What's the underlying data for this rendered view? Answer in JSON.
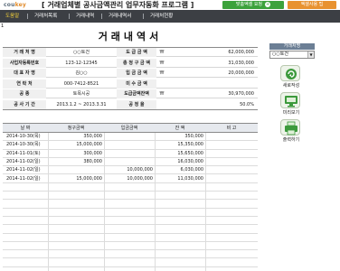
{
  "header": {
    "logo": "cou",
    "logo_accent": "key",
    "title": "[ 거래업체별 공사금액관리 업무자동화 프로그램 ]",
    "order_button": "맞춤엑셀 요청",
    "order_icon": "+",
    "excel_button": "엑셀사용 팁"
  },
  "menu": [
    "도움말",
    "거래처목록",
    "거래내역",
    "거래내역서",
    "거래처현황"
  ],
  "cell_marker": "1",
  "document_title": "거래내역서",
  "info": [
    {
      "label1": "거 래 처 명",
      "value1": "○○토건",
      "label2": "도 급 금 액",
      "won": "₩",
      "value2": "62,000,000"
    },
    {
      "label1": "사업자등록번호",
      "value1": "123-12-12345",
      "label2": "총 청 구 금 액",
      "won": "₩",
      "value2": "31,030,000"
    },
    {
      "label1": "대 표 자 명",
      "value1": "김○○",
      "label2": "입 금 금 액",
      "won": "₩",
      "value2": "20,000,000"
    },
    {
      "label1": "연 락 처",
      "value1": "000-7412-8521",
      "label2": "미 수 금 액",
      "won": "",
      "value2": ""
    },
    {
      "label1": "공 종",
      "value1": "토목시공",
      "label2": "도급금액잔액",
      "won": "₩",
      "value2": "30,970,000"
    },
    {
      "label1": "공 사 기 간",
      "value1": "2013.1.2 ~ 2013.3.31",
      "label2": "공 정 율",
      "won": "",
      "value2": "50.0%"
    }
  ],
  "ledger": {
    "headers": [
      "날 짜",
      "청구금액",
      "입금금액",
      "잔 액",
      "비 고"
    ],
    "rows": [
      {
        "date": "2014-10-30(목)",
        "claim": "350,000",
        "deposit": "",
        "balance": "350,000",
        "note": ""
      },
      {
        "date": "2014-10-30(목)",
        "claim": "15,000,000",
        "deposit": "",
        "balance": "15,350,000",
        "note": ""
      },
      {
        "date": "2014-11-01(토)",
        "claim": "300,000",
        "deposit": "",
        "balance": "15,650,000",
        "note": ""
      },
      {
        "date": "2014-11-02(일)",
        "claim": "380,000",
        "deposit": "",
        "balance": "16,030,000",
        "note": ""
      },
      {
        "date": "2014-11-02(일)",
        "claim": "",
        "deposit": "10,000,000",
        "balance": "6,030,000",
        "note": ""
      },
      {
        "date": "2014-11-02(일)",
        "claim": "15,000,000",
        "deposit": "10,000,000",
        "balance": "11,030,000",
        "note": ""
      }
    ]
  },
  "side": {
    "label": "거래처명",
    "selected": "○○토건",
    "buttons": [
      {
        "label": "새로작성",
        "icon": "refresh-icon"
      },
      {
        "label": "미리보기",
        "icon": "monitor-icon"
      },
      {
        "label": "출력하기",
        "icon": "printer-icon"
      }
    ]
  }
}
